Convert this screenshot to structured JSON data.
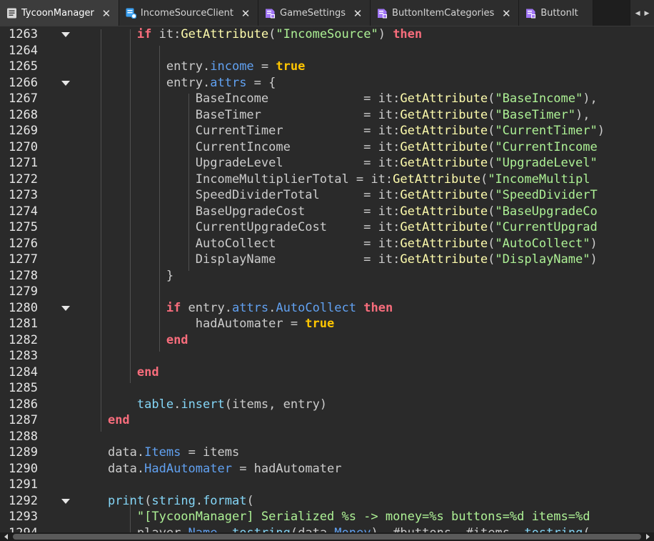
{
  "tabs": [
    {
      "label": "TycoonManager",
      "icon": "script-icon",
      "active": true
    },
    {
      "label": "IncomeSourceClient",
      "icon": "local-script-icon",
      "active": false
    },
    {
      "label": "GameSettings",
      "icon": "module-script-icon",
      "active": false
    },
    {
      "label": "ButtonItemCategories",
      "icon": "module-script-icon",
      "active": false
    },
    {
      "label": "ButtonIt",
      "icon": "module-script-icon",
      "active": false
    }
  ],
  "tab_close_glyph": "✕",
  "tab_scroll": {
    "left": "◀",
    "right": "▶"
  },
  "colors": {
    "keyword": "#f86d7c",
    "boolean": "#ffc600",
    "string": "#adf195",
    "function": "#fdfbac",
    "property": "#61a1f1",
    "builtin": "#84d6f7",
    "text": "#cccccc",
    "background": "#2a2a2a"
  },
  "editor": {
    "lines": [
      {
        "num": "1263",
        "fold": true,
        "tokens": [
          [
            "ws",
            "        "
          ],
          [
            "kw",
            "if"
          ],
          [
            "id",
            " it:"
          ],
          [
            "fn",
            "GetAttribute"
          ],
          [
            "id",
            "("
          ],
          [
            "str",
            "\"IncomeSource\""
          ],
          [
            "id",
            ") "
          ],
          [
            "kw",
            "then"
          ]
        ]
      },
      {
        "num": "1264",
        "fold": false,
        "tokens": []
      },
      {
        "num": "1265",
        "fold": false,
        "tokens": [
          [
            "ws",
            "            "
          ],
          [
            "id",
            "entry."
          ],
          [
            "prop",
            "income"
          ],
          [
            "id",
            " = "
          ],
          [
            "bool",
            "true"
          ]
        ]
      },
      {
        "num": "1266",
        "fold": true,
        "tokens": [
          [
            "ws",
            "            "
          ],
          [
            "id",
            "entry."
          ],
          [
            "prop",
            "attrs"
          ],
          [
            "id",
            " = {"
          ]
        ]
      },
      {
        "num": "1267",
        "fold": false,
        "tokens": [
          [
            "ws",
            "                "
          ],
          [
            "id",
            "BaseIncome             = it:"
          ],
          [
            "fn",
            "GetAttribute"
          ],
          [
            "id",
            "("
          ],
          [
            "str",
            "\"BaseIncome\""
          ],
          [
            "id",
            "),"
          ]
        ]
      },
      {
        "num": "1268",
        "fold": false,
        "tokens": [
          [
            "ws",
            "                "
          ],
          [
            "id",
            "BaseTimer              = it:"
          ],
          [
            "fn",
            "GetAttribute"
          ],
          [
            "id",
            "("
          ],
          [
            "str",
            "\"BaseTimer\""
          ],
          [
            "id",
            "),"
          ]
        ]
      },
      {
        "num": "1269",
        "fold": false,
        "tokens": [
          [
            "ws",
            "                "
          ],
          [
            "id",
            "CurrentTimer           = it:"
          ],
          [
            "fn",
            "GetAttribute"
          ],
          [
            "id",
            "("
          ],
          [
            "str",
            "\"CurrentTimer\""
          ],
          [
            "id",
            ")"
          ]
        ]
      },
      {
        "num": "1270",
        "fold": false,
        "tokens": [
          [
            "ws",
            "                "
          ],
          [
            "id",
            "CurrentIncome          = it:"
          ],
          [
            "fn",
            "GetAttribute"
          ],
          [
            "id",
            "("
          ],
          [
            "str",
            "\"CurrentIncome"
          ]
        ]
      },
      {
        "num": "1271",
        "fold": false,
        "tokens": [
          [
            "ws",
            "                "
          ],
          [
            "id",
            "UpgradeLevel           = it:"
          ],
          [
            "fn",
            "GetAttribute"
          ],
          [
            "id",
            "("
          ],
          [
            "str",
            "\"UpgradeLevel\""
          ]
        ]
      },
      {
        "num": "1272",
        "fold": false,
        "tokens": [
          [
            "ws",
            "                "
          ],
          [
            "id",
            "IncomeMultiplierTotal = it:"
          ],
          [
            "fn",
            "GetAttribute"
          ],
          [
            "id",
            "("
          ],
          [
            "str",
            "\"IncomeMultipl"
          ]
        ]
      },
      {
        "num": "1273",
        "fold": false,
        "tokens": [
          [
            "ws",
            "                "
          ],
          [
            "id",
            "SpeedDividerTotal      = it:"
          ],
          [
            "fn",
            "GetAttribute"
          ],
          [
            "id",
            "("
          ],
          [
            "str",
            "\"SpeedDividerT"
          ]
        ]
      },
      {
        "num": "1274",
        "fold": false,
        "tokens": [
          [
            "ws",
            "                "
          ],
          [
            "id",
            "BaseUpgradeCost        = it:"
          ],
          [
            "fn",
            "GetAttribute"
          ],
          [
            "id",
            "("
          ],
          [
            "str",
            "\"BaseUpgradeCo"
          ]
        ]
      },
      {
        "num": "1275",
        "fold": false,
        "tokens": [
          [
            "ws",
            "                "
          ],
          [
            "id",
            "CurrentUpgradeCost     = it:"
          ],
          [
            "fn",
            "GetAttribute"
          ],
          [
            "id",
            "("
          ],
          [
            "str",
            "\"CurrentUpgrad"
          ]
        ]
      },
      {
        "num": "1276",
        "fold": false,
        "tokens": [
          [
            "ws",
            "                "
          ],
          [
            "id",
            "AutoCollect            = it:"
          ],
          [
            "fn",
            "GetAttribute"
          ],
          [
            "id",
            "("
          ],
          [
            "str",
            "\"AutoCollect\""
          ],
          [
            "id",
            ")"
          ]
        ]
      },
      {
        "num": "1277",
        "fold": false,
        "tokens": [
          [
            "ws",
            "                "
          ],
          [
            "id",
            "DisplayName            = it:"
          ],
          [
            "fn",
            "GetAttribute"
          ],
          [
            "id",
            "("
          ],
          [
            "str",
            "\"DisplayName\""
          ],
          [
            "id",
            ")"
          ]
        ]
      },
      {
        "num": "1278",
        "fold": false,
        "tokens": [
          [
            "ws",
            "            "
          ],
          [
            "id",
            "}"
          ]
        ]
      },
      {
        "num": "1279",
        "fold": false,
        "tokens": []
      },
      {
        "num": "1280",
        "fold": true,
        "tokens": [
          [
            "ws",
            "            "
          ],
          [
            "kw",
            "if"
          ],
          [
            "id",
            " entry."
          ],
          [
            "prop",
            "attrs"
          ],
          [
            "id",
            "."
          ],
          [
            "prop",
            "AutoCollect"
          ],
          [
            "id",
            " "
          ],
          [
            "kw",
            "then"
          ]
        ]
      },
      {
        "num": "1281",
        "fold": false,
        "tokens": [
          [
            "ws",
            "                "
          ],
          [
            "id",
            "hadAutomater = "
          ],
          [
            "bool",
            "true"
          ]
        ]
      },
      {
        "num": "1282",
        "fold": false,
        "tokens": [
          [
            "ws",
            "            "
          ],
          [
            "kw",
            "end"
          ]
        ]
      },
      {
        "num": "1283",
        "fold": false,
        "tokens": []
      },
      {
        "num": "1284",
        "fold": false,
        "tokens": [
          [
            "ws",
            "        "
          ],
          [
            "kw",
            "end"
          ]
        ]
      },
      {
        "num": "1285",
        "fold": false,
        "tokens": []
      },
      {
        "num": "1286",
        "fold": false,
        "tokens": [
          [
            "ws",
            "        "
          ],
          [
            "lib",
            "table"
          ],
          [
            "id",
            "."
          ],
          [
            "lib",
            "insert"
          ],
          [
            "id",
            "(items, entry)"
          ]
        ]
      },
      {
        "num": "1287",
        "fold": false,
        "tokens": [
          [
            "ws",
            "    "
          ],
          [
            "kw",
            "end"
          ]
        ]
      },
      {
        "num": "1288",
        "fold": false,
        "tokens": []
      },
      {
        "num": "1289",
        "fold": false,
        "tokens": [
          [
            "ws",
            "    "
          ],
          [
            "id",
            "data."
          ],
          [
            "prop",
            "Items"
          ],
          [
            "id",
            " = items"
          ]
        ]
      },
      {
        "num": "1290",
        "fold": false,
        "tokens": [
          [
            "ws",
            "    "
          ],
          [
            "id",
            "data."
          ],
          [
            "prop",
            "HadAutomater"
          ],
          [
            "id",
            " = hadAutomater"
          ]
        ]
      },
      {
        "num": "1291",
        "fold": false,
        "tokens": []
      },
      {
        "num": "1292",
        "fold": true,
        "tokens": [
          [
            "ws",
            "    "
          ],
          [
            "lib",
            "print"
          ],
          [
            "id",
            "("
          ],
          [
            "lib",
            "string"
          ],
          [
            "id",
            "."
          ],
          [
            "lib",
            "format"
          ],
          [
            "id",
            "("
          ]
        ]
      },
      {
        "num": "1293",
        "fold": false,
        "tokens": [
          [
            "ws",
            "        "
          ],
          [
            "str",
            "\"[TycoonManager] Serialized %s -> money=%s buttons=%d items=%d"
          ]
        ]
      },
      {
        "num": "1294",
        "fold": false,
        "tokens": [
          [
            "ws",
            "        "
          ],
          [
            "id",
            "player."
          ],
          [
            "prop",
            "Name"
          ],
          [
            "id",
            ", "
          ],
          [
            "lib",
            "tostring"
          ],
          [
            "id",
            "(data."
          ],
          [
            "prop",
            "Money"
          ],
          [
            "id",
            "), #buttons, #items, "
          ],
          [
            "lib",
            "tostring"
          ],
          [
            "id",
            "("
          ]
        ]
      }
    ]
  }
}
